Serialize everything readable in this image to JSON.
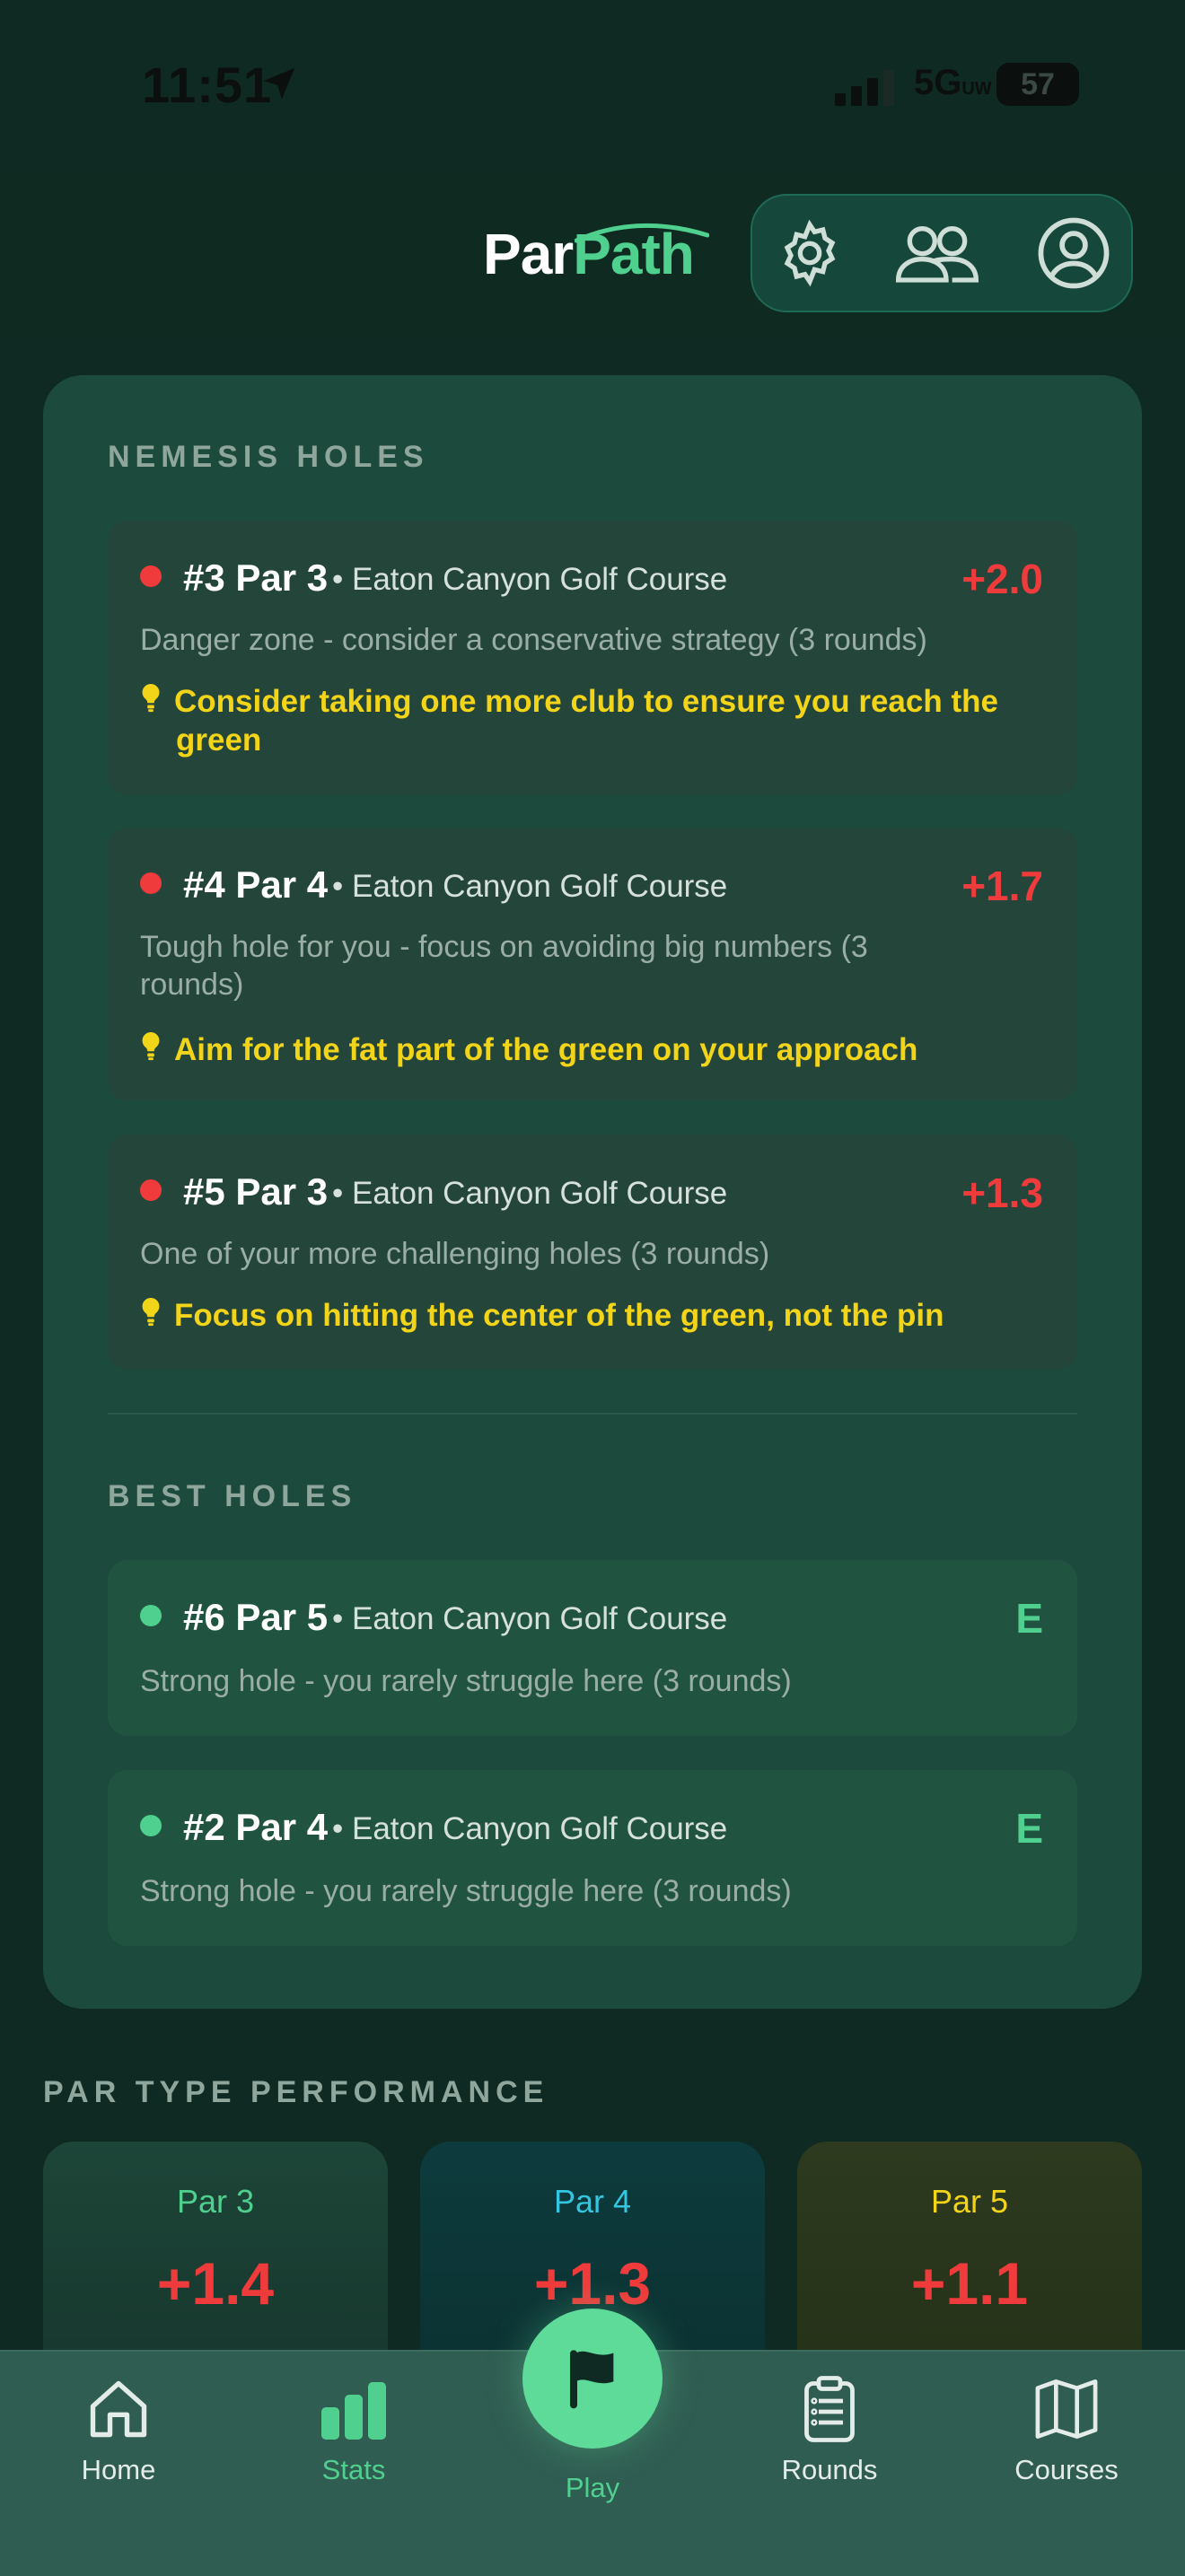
{
  "status_bar": {
    "time": "11:51",
    "network": "5G",
    "network_sub": "UW",
    "battery": "57"
  },
  "header": {
    "logo_part1": "Par",
    "logo_part2": "Path"
  },
  "nemesis": {
    "title": "NEMESIS HOLES",
    "holes": [
      {
        "title": "#3 Par 3",
        "course": "Eaton Canyon Golf Course",
        "score": "+2.0",
        "desc": "Danger zone - consider a conservative strategy (3 rounds)",
        "tip": "Consider taking one more club to ensure you reach the green"
      },
      {
        "title": "#4 Par 4",
        "course": "Eaton Canyon Golf Course",
        "score": "+1.7",
        "desc": "Tough hole for you - focus on avoiding big numbers (3 rounds)",
        "tip": "Aim for the fat part of the green on your approach"
      },
      {
        "title": "#5 Par 3",
        "course": "Eaton Canyon Golf Course",
        "score": "+1.3",
        "desc": "One of your more challenging holes (3 rounds)",
        "tip": "Focus on hitting the center of the green, not the pin"
      }
    ]
  },
  "best": {
    "title": "BEST HOLES",
    "holes": [
      {
        "title": "#6 Par 5",
        "course": "Eaton Canyon Golf Course",
        "score": "E",
        "desc": "Strong hole - you rarely struggle here (3 rounds)"
      },
      {
        "title": "#2 Par 4",
        "course": "Eaton Canyon Golf Course",
        "score": "E",
        "desc": "Strong hole - you rarely struggle here (3 rounds)"
      }
    ]
  },
  "par_performance": {
    "title": "PAR TYPE PERFORMANCE",
    "cards": [
      {
        "name": "Par 3",
        "value": "+1.4"
      },
      {
        "name": "Par 4",
        "value": "+1.3"
      },
      {
        "name": "Par 5",
        "value": "+1.1"
      }
    ]
  },
  "nav": {
    "home": "Home",
    "stats": "Stats",
    "play": "Play",
    "rounds": "Rounds",
    "courses": "Courses",
    "active": "stats"
  },
  "colors": {
    "accent": "#4fd08f",
    "danger": "#ef3b3b",
    "tip": "#f2d419",
    "card": "#1c4a3c"
  }
}
